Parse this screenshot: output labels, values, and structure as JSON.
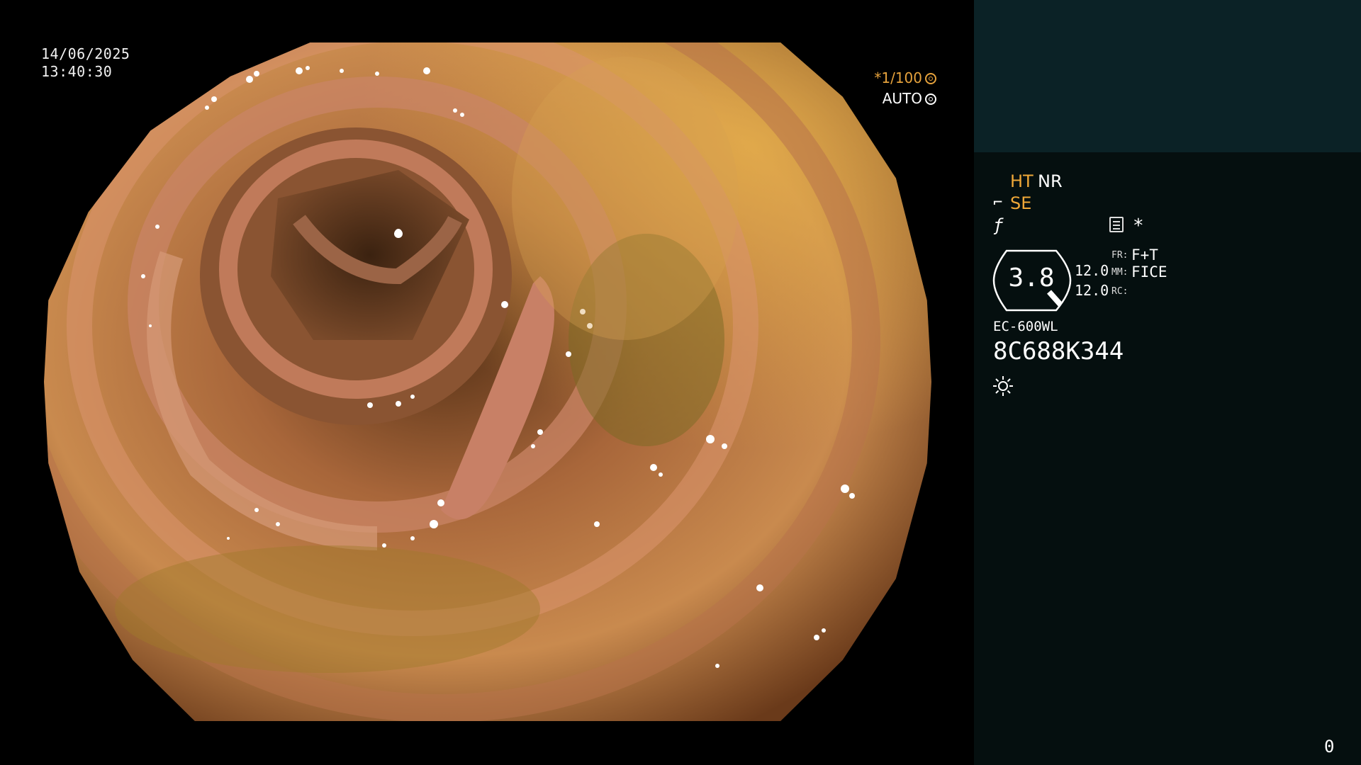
{
  "datetime": {
    "date": "14/06/2025",
    "time": "13:40:30"
  },
  "exposure": {
    "shutter": "*1/100",
    "mode": "AUTO",
    "shutter_icon": "aperture-icon",
    "mode_icon": "aperture-icon"
  },
  "panel": {
    "ht": "HT",
    "nr": "NR",
    "se": "SE",
    "se_icon": "enhance-icon",
    "fn_icon": "function-icon",
    "menu_icon": "menu-icon",
    "star": "*",
    "gauge_value": "3.8",
    "row1_value": "12.0",
    "row2_value": "12.0",
    "fr_label": "FR:",
    "fr_value": "F+T",
    "mm_label": "MM:",
    "mm_value": "FICE",
    "rc_label": "RC:",
    "model": "EC-600WL",
    "serial": "8C688K344",
    "light_icon": "light-icon"
  },
  "counter": "0",
  "colors": {
    "accent": "#f0a838",
    "panel_top": "#0b2226",
    "panel": "#050f0f"
  }
}
